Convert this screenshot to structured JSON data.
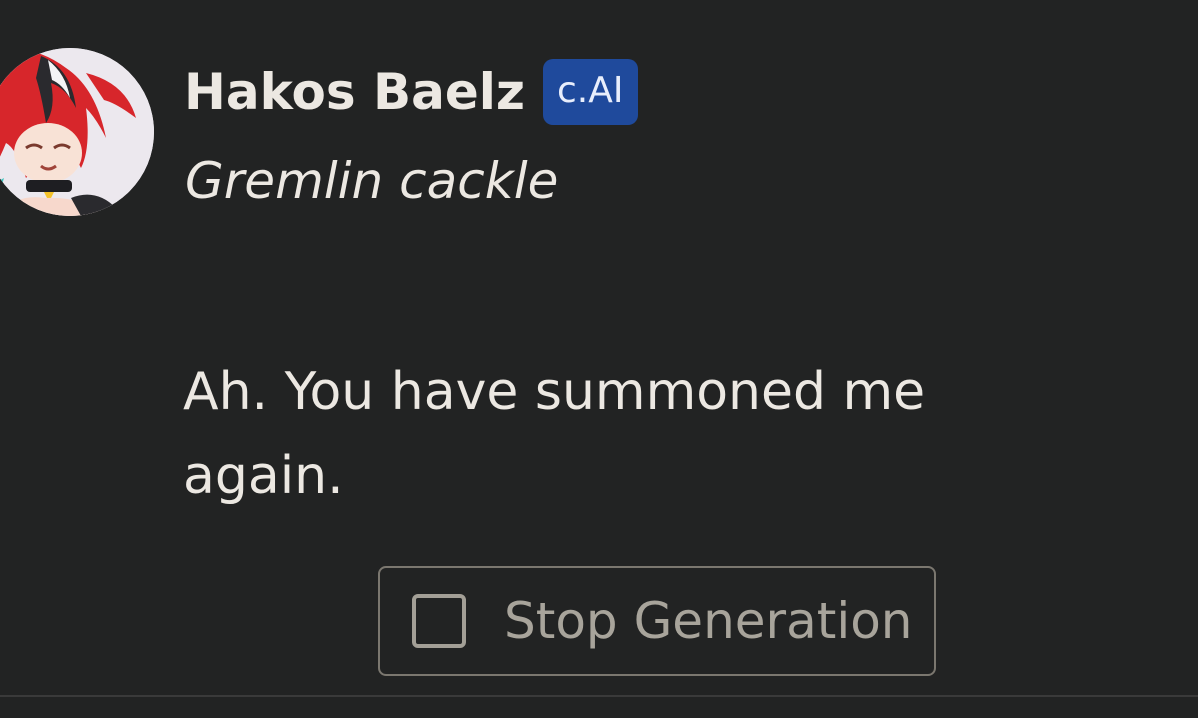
{
  "message": {
    "character_name": "Hakos Baelz",
    "badge": "c.AI",
    "action": "Gremlin cackle",
    "text": "Ah. You have summoned me again."
  },
  "stop_button": {
    "label": "Stop Generation",
    "icon": "stop-square-icon"
  },
  "colors": {
    "background": "#222323",
    "badge": "#1f4a9c",
    "text": "#ece8e2",
    "button_border": "#7b776f"
  }
}
